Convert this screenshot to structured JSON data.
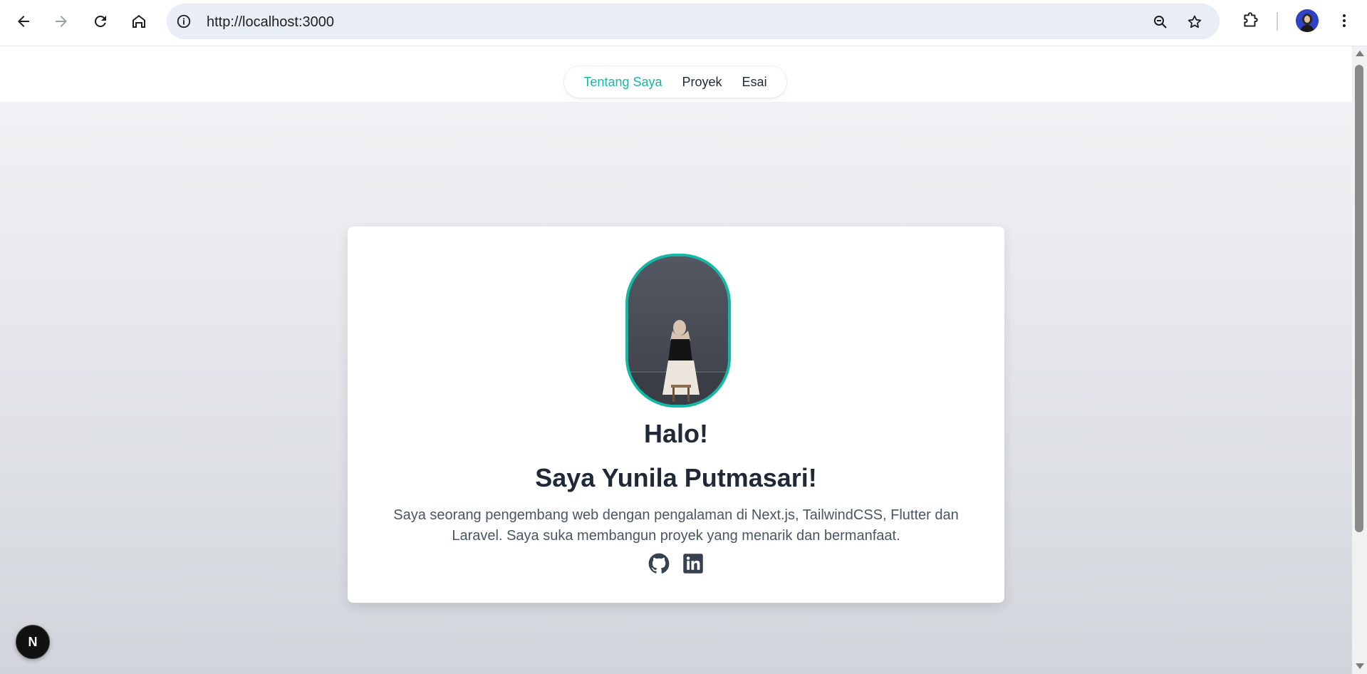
{
  "browser": {
    "url": "http://localhost:3000",
    "icons": [
      "back-icon",
      "forward-icon",
      "reload-icon",
      "home-icon",
      "site-info-icon",
      "zoom-icon",
      "bookmark-star-icon",
      "extensions-icon",
      "profile-avatar",
      "more-menu-icon"
    ]
  },
  "nav": {
    "items": [
      {
        "label": "Tentang Saya",
        "active": true
      },
      {
        "label": "Proyek",
        "active": false
      },
      {
        "label": "Esai",
        "active": false
      }
    ],
    "accent_color": "#14b8a6"
  },
  "profile": {
    "greeting": "Halo!",
    "name_line": "Saya Yunila Putmasari!",
    "bio": "Saya seorang pengembang web dengan pengalaman di Next.js, TailwindCSS, Flutter dan Laravel. Saya suka membangun proyek yang menarik dan bermanfaat.",
    "socials": [
      "github-icon",
      "linkedin-icon"
    ]
  },
  "dev_badge": {
    "label": "N"
  }
}
